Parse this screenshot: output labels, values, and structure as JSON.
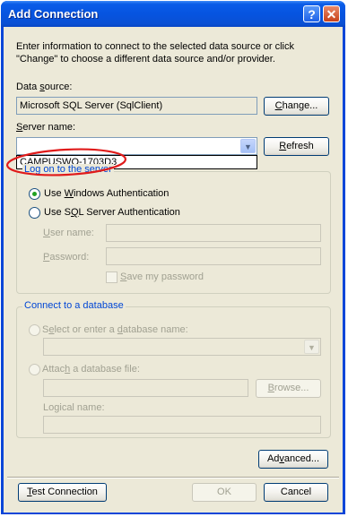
{
  "window": {
    "title": "Add Connection",
    "help_glyph": "?",
    "close_glyph": "✕"
  },
  "intro": "Enter information to connect to the selected data source or click \"Change\" to choose a different data source and/or provider.",
  "data_source": {
    "label": "Data source:",
    "value": "Microsoft SQL Server (SqlClient)",
    "change_label": "Change..."
  },
  "server_name": {
    "label": "Server name:",
    "value": "",
    "refresh_label": "Refresh",
    "dropdown_items": [
      "CAMPUSWO-1703D3"
    ]
  },
  "logon": {
    "title": "Log on to the server",
    "windows_auth": "Use Windows Authentication",
    "sql_auth": "Use SQL Server Authentication",
    "user_name_label": "User name:",
    "password_label": "Password:",
    "save_password": "Save my password",
    "selected": "windows"
  },
  "database": {
    "title": "Connect to a database",
    "select_label": "Select or enter a database name:",
    "attach_label": "Attach a database file:",
    "browse_label": "Browse...",
    "logical_label": "Logical name:"
  },
  "buttons": {
    "advanced": "Advanced...",
    "test": "Test Connection",
    "ok": "OK",
    "cancel": "Cancel"
  },
  "annotation": {
    "color": "#e01b1b"
  }
}
